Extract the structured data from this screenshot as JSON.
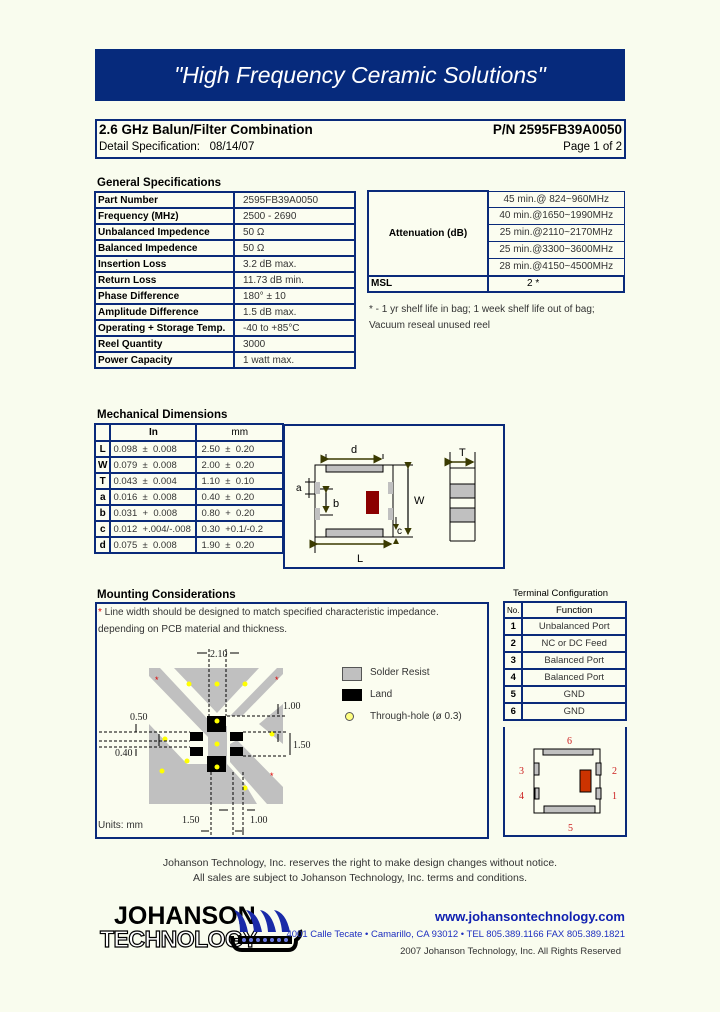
{
  "banner": {
    "title": "\"High Frequency Ceramic Solutions\""
  },
  "header": {
    "product_title": "2.6 GHz Balun/Filter Combination",
    "part_number_label": "P/N 2595FB39A0050",
    "detail_spec": "Detail Specification:   08/14/07",
    "page": "Page 1 of 2"
  },
  "general_specs": {
    "title": "General Specifications",
    "rows": [
      {
        "label": "Part Number",
        "value": "2595FB39A0050"
      },
      {
        "label": "Frequency (MHz)",
        "value": "2500 - 2690"
      },
      {
        "label": "Unbalanced Impedence",
        "value": "50 Ω"
      },
      {
        "label": "Balanced Impedence",
        "value": "50 Ω"
      },
      {
        "label": "Insertion Loss",
        "value": "3.2 dB max."
      },
      {
        "label": "Return Loss",
        "value": "11.73 dB min."
      },
      {
        "label": "Phase Difference",
        "value": "180° ± 10"
      },
      {
        "label": "Amplitude Difference",
        "value": "1.5 dB max."
      },
      {
        "label": "Operating + Storage Temp.",
        "value": "-40 to +85°C"
      },
      {
        "label": "Reel Quantity",
        "value": "3000"
      },
      {
        "label": "Power Capacity",
        "value": "1 watt max."
      }
    ]
  },
  "attenuation": {
    "label": "Attenuation (dB)",
    "values": [
      "45 min.@ 824~960MHz",
      "40 min.@1650~1990MHz",
      "25 min.@2110~2170MHz",
      "25 min.@3300~3600MHz",
      "28 min.@4150~4500MHz"
    ],
    "msl_label": "MSL",
    "msl_value": "2 *",
    "footnote_line1": "* - 1 yr shelf life in bag; 1 week shelf life out of bag;",
    "footnote_line2": "Vacuum reseal unused reel"
  },
  "mechanical": {
    "title": "Mechanical Dimensions",
    "col_in": "In",
    "col_mm": "mm",
    "rows": [
      {
        "dim": "L",
        "in_val": "0.098",
        "in_tol": "±  0.008",
        "mm_val": "2.50",
        "mm_tol": "±  0.20"
      },
      {
        "dim": "W",
        "in_val": "0.079",
        "in_tol": "±  0.008",
        "mm_val": "2.00",
        "mm_tol": "±  0.20"
      },
      {
        "dim": "T",
        "in_val": "0.043",
        "in_tol": "±  0.004",
        "mm_val": "1.10",
        "mm_tol": "±  0.10"
      },
      {
        "dim": "a",
        "in_val": "0.016",
        "in_tol": "±  0.008",
        "mm_val": "0.40",
        "mm_tol": "±  0.20"
      },
      {
        "dim": "b",
        "in_val": "0.031",
        "in_tol": "+  0.008",
        "mm_val": "0.80",
        "mm_tol": "+  0.20"
      },
      {
        "dim": "c",
        "in_val": "0.012",
        "in_tol": "+.004/-.008",
        "mm_val": "0.30",
        "mm_tol": "+0.1/-0.2"
      },
      {
        "dim": "d",
        "in_val": "0.075",
        "in_tol": "±  0.008",
        "mm_val": "1.90",
        "mm_tol": "±  0.20"
      }
    ],
    "diagram_labels": {
      "d": "d",
      "a": "a",
      "b": "b",
      "W": "W",
      "c": "c",
      "L": "L",
      "T": "T"
    }
  },
  "mounting": {
    "title": "Mounting Considerations",
    "note_marker": "*",
    "note_line1": " Line width should be designed to match specified characteristic impedance.",
    "note_line2": "depending on PCB material and thickness.",
    "dims": {
      "top": "2.10",
      "right_top": "1.00",
      "right_mid": "1.50",
      "left_top": "0.50",
      "left_bot": "0.40",
      "bottom_left": "1.50",
      "bottom_right": "1.00"
    },
    "legend": [
      {
        "label": "Solder Resist",
        "swatch": "solder-resist"
      },
      {
        "label": "Land",
        "swatch": "land"
      },
      {
        "label": "Through-hole (ø 0.3)",
        "swatch": "through-hole"
      }
    ],
    "units": "Units: mm",
    "colors": {
      "solder_resist": "#c0c0c0",
      "land": "#000000",
      "through_hole": "#ffff00",
      "marker": "#e00000"
    }
  },
  "terminal": {
    "title": "Terminal Configuration",
    "col_no": "No.",
    "col_function": "Function",
    "rows": [
      {
        "no": "1",
        "function": "Unbalanced Port"
      },
      {
        "no": "2",
        "function": "NC or DC Feed"
      },
      {
        "no": "3",
        "function": "Balanced Port"
      },
      {
        "no": "4",
        "function": "Balanced Port"
      },
      {
        "no": "5",
        "function": "GND"
      },
      {
        "no": "6",
        "function": "GND"
      }
    ],
    "pin_labels": {
      "p1": "1",
      "p2": "2",
      "p3": "3",
      "p4": "4",
      "p5": "5",
      "p6": "6"
    }
  },
  "footer": {
    "notice_line1": "Johanson Technology, Inc. reserves the right to make design changes without notice.",
    "notice_line2": "All sales are subject to Johanson Technology, Inc. terms and conditions.",
    "logo_line1": "JOHANSON",
    "logo_line2": "TECHNOLOGY",
    "url": "www.johansontechnology.com",
    "address": "4001 Calle Tecate • Camarillo, CA 93012 • TEL 805.389.1166 FAX 805.389.1821",
    "copyright": "2007 Johanson Technology, Inc.  All Rights Reserved"
  },
  "colors": {
    "brand_navy": "#062a7c",
    "page_bg": "#f9fcee",
    "chip_marker": "#8b0000",
    "terminal_marker": "#cc3300"
  }
}
